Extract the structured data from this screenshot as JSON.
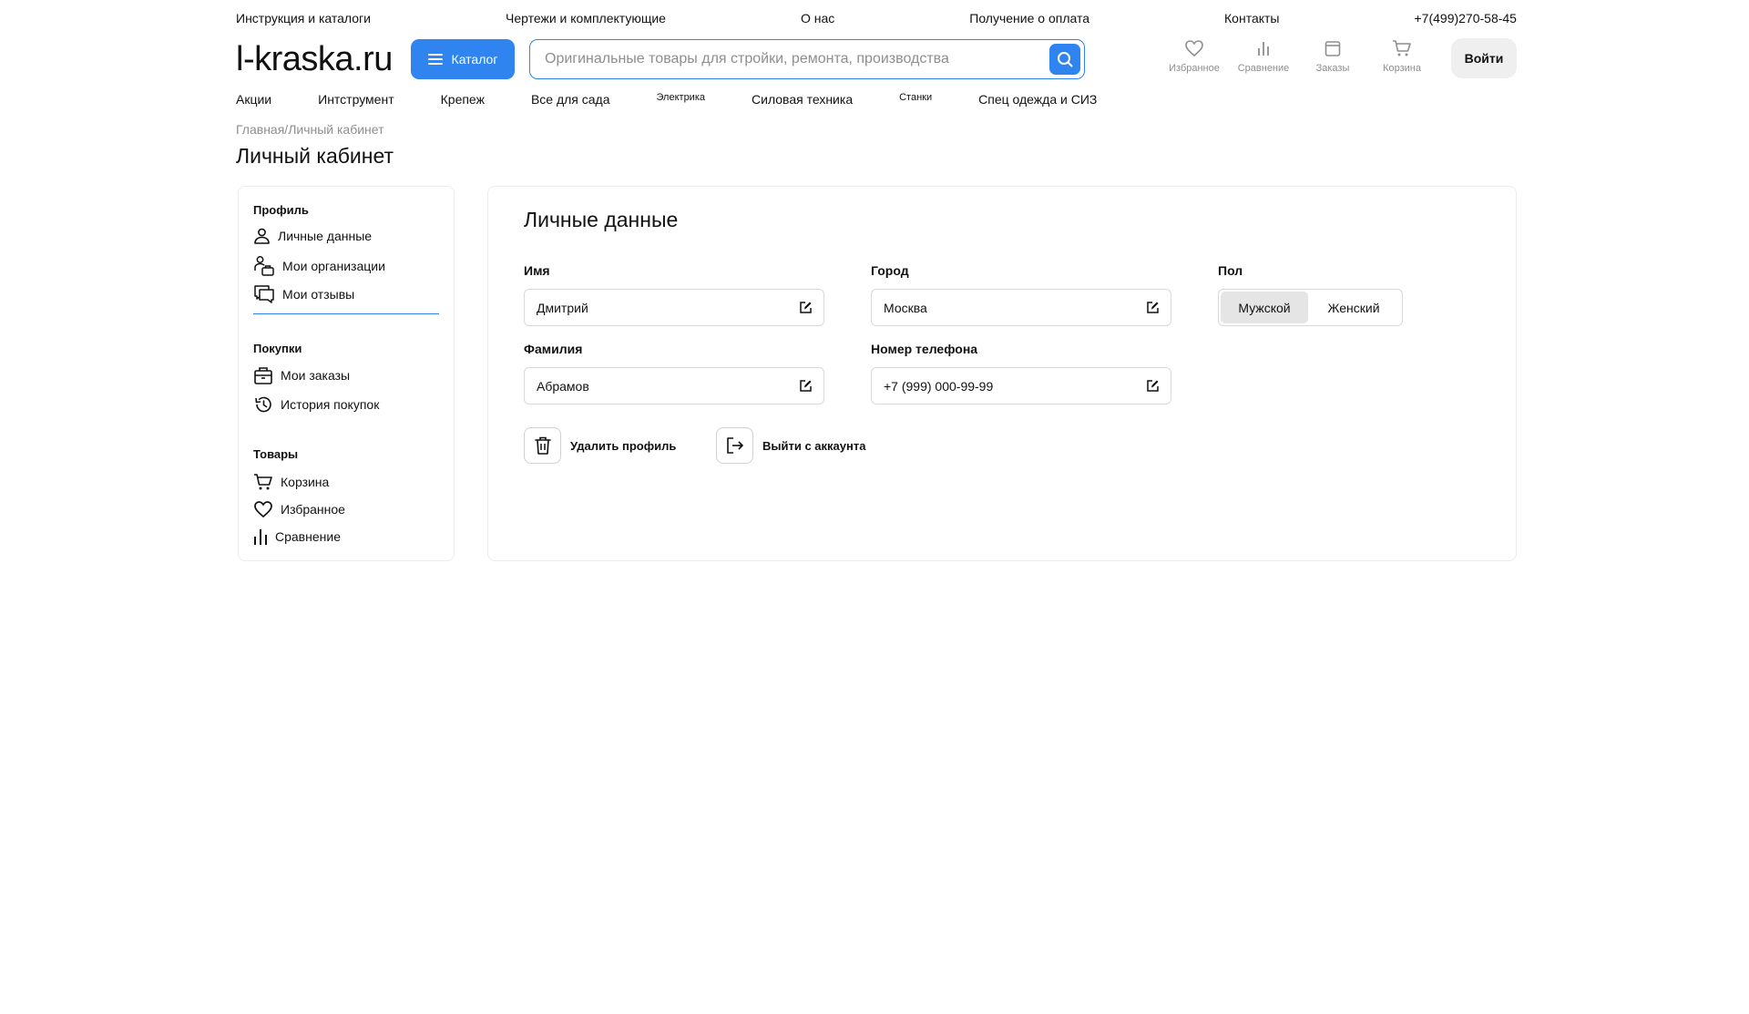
{
  "topbar": {
    "links": [
      "Инструкция и каталоги",
      "Чертежи и комплектующие",
      "О нас",
      "Получение о оплата",
      "Контакты"
    ],
    "phone": "+7(499)270-58-45"
  },
  "header": {
    "logo": "l-kraska.ru",
    "catalog_label": "Каталог",
    "search_placeholder": "Оригинальные товары для стройки, ремонта, производства",
    "search_value": "",
    "icons": [
      {
        "label": "Избранное",
        "icon": "heart-icon"
      },
      {
        "label": "Сравнение",
        "icon": "chart-icon"
      },
      {
        "label": "Заказы",
        "icon": "orders-icon"
      },
      {
        "label": "Корзина",
        "icon": "cart-icon"
      }
    ],
    "login_label": "Войти"
  },
  "catnav": {
    "items": [
      "Акции",
      "Интструмент",
      "Крепеж",
      "Все для сада",
      "Электрика",
      "Силовая техника",
      "Станки",
      "Спец одежда и СИЗ"
    ]
  },
  "breadcrumb": {
    "home": "Главная",
    "sep": "/",
    "current": "Личный кабинет"
  },
  "page_title": "Личный кабинет",
  "sidebar": {
    "groups": [
      {
        "title": "Профиль",
        "items": [
          {
            "label": "Личные данные",
            "icon": "person-icon"
          },
          {
            "label": "Мои организации",
            "icon": "organizations-icon"
          },
          {
            "label": "Мои отзывы",
            "icon": "reviews-icon"
          }
        ]
      },
      {
        "title": "Покупки",
        "items": [
          {
            "label": "Мои заказы",
            "icon": "bag-icon"
          },
          {
            "label": "История покупок",
            "icon": "history-icon"
          }
        ]
      },
      {
        "title": "Товары",
        "items": [
          {
            "label": "Корзина",
            "icon": "cart-icon"
          },
          {
            "label": "Избранное",
            "icon": "heart-icon"
          },
          {
            "label": "Сравнение",
            "icon": "chart-icon"
          }
        ]
      }
    ]
  },
  "personal": {
    "title": "Личные данные",
    "first_name": {
      "label": "Имя",
      "value": "Дмитрий"
    },
    "last_name": {
      "label": "Фамилия",
      "value": "Абрамов"
    },
    "city": {
      "label": "Город",
      "value": "Москва"
    },
    "phone": {
      "label": "Номер телефона",
      "value": "+7 (999) 000-99-99"
    },
    "gender": {
      "label": "Пол",
      "options": [
        "Мужской",
        "Женский"
      ],
      "selected": "Мужской"
    },
    "delete_label": "Удалить профиль",
    "logout_label": "Выйти с аккаунта"
  },
  "colors": {
    "accent": "#2f84f0",
    "muted": "#8e8e8e",
    "border": "#d9d9d9"
  }
}
